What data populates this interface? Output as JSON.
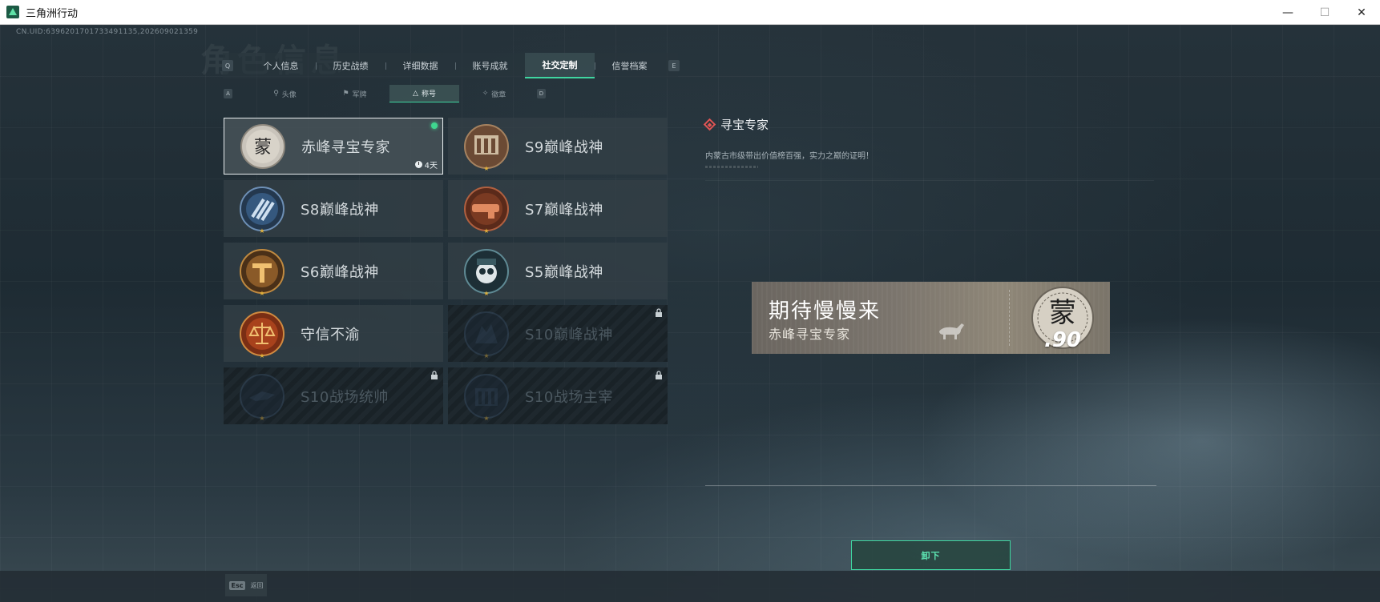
{
  "window": {
    "title": "三角洲行动",
    "minimize": "—",
    "maximize": "☐",
    "close": "✕"
  },
  "uid_text": "CN.UID:639620170173349113​5,202609021359",
  "watermark": "角色信息",
  "tabs": {
    "left_key": "Q",
    "right_key": "E",
    "items": [
      {
        "label": "个人信息",
        "active": false
      },
      {
        "label": "历史战绩",
        "active": false
      },
      {
        "label": "详细数据",
        "active": false
      },
      {
        "label": "账号成就",
        "active": false
      },
      {
        "label": "社交定制",
        "active": true
      },
      {
        "label": "信誉档案",
        "active": false
      }
    ]
  },
  "subtabs": {
    "left_key": "A",
    "right_key": "D",
    "items": [
      {
        "label": "头像",
        "icon": "person-icon",
        "active": false
      },
      {
        "label": "军牌",
        "icon": "tag-icon",
        "active": false
      },
      {
        "label": "称号",
        "icon": "triangle-icon",
        "active": true
      },
      {
        "label": "徽章",
        "icon": "medal-icon",
        "active": false
      }
    ]
  },
  "titles": [
    {
      "label": "赤峰寻宝专家",
      "badge": "mongol-badge",
      "equipped": true,
      "selected": true,
      "timer": "4天",
      "locked": false
    },
    {
      "label": "S9巅峰战神",
      "badge": "s9-badge",
      "equipped": false,
      "selected": false,
      "locked": false
    },
    {
      "label": "S8巅峰战神",
      "badge": "s8-badge",
      "equipped": false,
      "selected": false,
      "locked": false
    },
    {
      "label": "S7巅峰战神",
      "badge": "s7-badge",
      "equipped": false,
      "selected": false,
      "locked": false
    },
    {
      "label": "S6巅峰战神",
      "badge": "s6-badge",
      "equipped": false,
      "selected": false,
      "locked": false
    },
    {
      "label": "S5巅峰战神",
      "badge": "s5-badge",
      "equipped": false,
      "selected": false,
      "locked": false
    },
    {
      "label": "守信不渝",
      "badge": "scales-badge",
      "equipped": false,
      "selected": false,
      "locked": false
    },
    {
      "label": "S10巅峰战神",
      "badge": "s10-badge",
      "equipped": false,
      "selected": false,
      "locked": true
    },
    {
      "label": "S10战场统帅",
      "badge": "s10-commander-badge",
      "equipped": false,
      "selected": false,
      "locked": true
    },
    {
      "label": "S10战场主宰",
      "badge": "s10-dominator-badge",
      "equipped": false,
      "selected": false,
      "locked": true
    }
  ],
  "detail": {
    "title": "寻宝专家",
    "description": "内蒙古市级带出价值榜百强，实力之巅的证明！"
  },
  "nameplate": {
    "main_text": "期待慢慢来",
    "sub_text": "赤峰寻宝专家",
    "number": ".90",
    "emblem_char": "蒙"
  },
  "actions": {
    "unequip_label": "卸下",
    "back_key": "Esc",
    "back_label": "返回"
  },
  "colors": {
    "accent": "#3fd6a0",
    "equipped_dot": "#3fd68f",
    "diamond": "#e05555"
  }
}
